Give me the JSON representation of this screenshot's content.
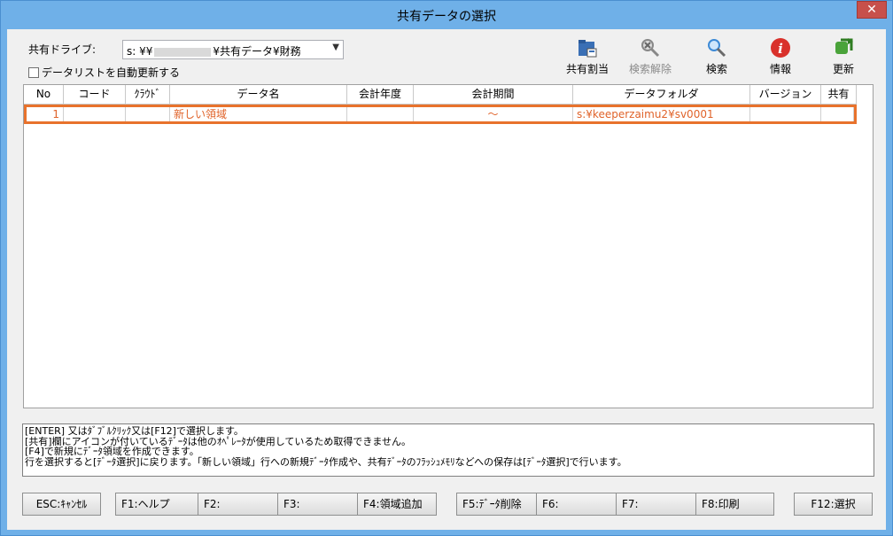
{
  "window": {
    "title": "共有データの選択",
    "close_glyph": "✕"
  },
  "drive": {
    "label": "共有ドライブ:",
    "value_prefix": "s: ¥¥",
    "value_suffix": "¥共有データ¥財務"
  },
  "auto_refresh": {
    "label": "データリストを自動更新する",
    "checked": false
  },
  "toolbar": [
    {
      "id": "share",
      "label": "共有割当",
      "icon": "folder-share-icon",
      "enabled": true
    },
    {
      "id": "clear",
      "label": "検索解除",
      "icon": "search-clear-icon",
      "enabled": false
    },
    {
      "id": "search",
      "label": "検索",
      "icon": "search-icon",
      "enabled": true
    },
    {
      "id": "info",
      "label": "情報",
      "icon": "info-icon",
      "enabled": true
    },
    {
      "id": "refresh",
      "label": "更新",
      "icon": "refresh-icon",
      "enabled": true
    }
  ],
  "table": {
    "columns": [
      "No",
      "コード",
      "ｸﾗｳﾄﾞ",
      "データ名",
      "会計年度",
      "会計期間",
      "データフォルダ",
      "バージョン",
      "共有"
    ],
    "rows": [
      {
        "no": "1",
        "code": "",
        "cloud": "",
        "name": "新しい領域",
        "year": "",
        "period": "～",
        "folder": "s:¥keeperzaimu2¥sv0001",
        "version": "",
        "shared": ""
      }
    ]
  },
  "help_lines": [
    "[ENTER] 又はﾀﾞﾌﾞﾙｸﾘｯｸ又は[F12]で選択します。",
    "[共有]欄にアイコンが付いているﾃﾞｰﾀは他のｵﾍﾟﾚｰﾀが使用しているため取得できません。",
    "[F4]で新規にﾃﾞｰﾀ領域を作成できます。",
    "行を選択すると[ﾃﾞｰﾀ選択]に戻ります。「新しい領域」行への新規ﾃﾞｰﾀ作成や、共有ﾃﾞｰﾀのﾌﾗｯｼｭﾒﾓﾘなどへの保存は[ﾃﾞｰﾀ選択]で行います。"
  ],
  "fkeys": {
    "esc": "ESC:ｷｬﾝｾﾙ",
    "f1": "F1:ヘルプ",
    "f2": "F2:",
    "f3": "F3:",
    "f4": "F4:領域追加",
    "f5": "F5:ﾃﾞｰﾀ削除",
    "f6": "F6:",
    "f7": "F7:",
    "f8": "F8:印刷",
    "f12": "F12:選択"
  },
  "colors": {
    "accent": "#e8722c",
    "titlebar": "#6fb0e8",
    "close": "#c7504b"
  }
}
